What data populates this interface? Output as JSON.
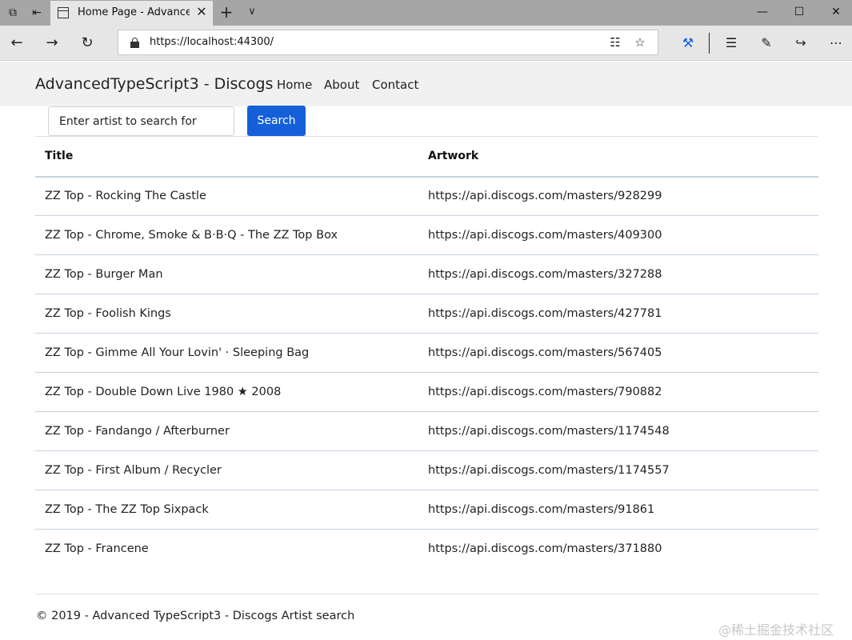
{
  "browser": {
    "tab_title": "Home Page - Advanced",
    "url": "https://localhost:44300/",
    "icons": {
      "tab_actions": "⧉",
      "back_to_tabs": "⇤",
      "close_tab": "✕",
      "new_tab": "+",
      "tab_menu": "∨",
      "minimize": "—",
      "maximize": "☐",
      "close_window": "✕",
      "back": "←",
      "forward": "→",
      "refresh": "↻",
      "reading_view": "☷",
      "favorite": "☆",
      "extension": "⚒",
      "favorites_hub": "☰",
      "pen": "✎",
      "share": "↪",
      "more": "⋯"
    }
  },
  "header": {
    "brand": "AdvancedTypeScript3 - Discogs",
    "nav": [
      "Home",
      "About",
      "Contact"
    ]
  },
  "search": {
    "placeholder": "Enter artist to search for",
    "button_label": "Search"
  },
  "table": {
    "headers": [
      "Title",
      "Artwork"
    ],
    "rows": [
      [
        "ZZ Top - Rocking The Castle",
        "https://api.discogs.com/masters/928299"
      ],
      [
        "ZZ Top - Chrome, Smoke & B·B·Q - The ZZ Top Box",
        "https://api.discogs.com/masters/409300"
      ],
      [
        "ZZ Top - Burger Man",
        "https://api.discogs.com/masters/327288"
      ],
      [
        "ZZ Top - Foolish Kings",
        "https://api.discogs.com/masters/427781"
      ],
      [
        "ZZ Top - Gimme All Your Lovin' · Sleeping Bag",
        "https://api.discogs.com/masters/567405"
      ],
      [
        "ZZ Top - Double Down Live 1980 ★ 2008",
        "https://api.discogs.com/masters/790882"
      ],
      [
        "ZZ Top - Fandango / Afterburner",
        "https://api.discogs.com/masters/1174548"
      ],
      [
        "ZZ Top - First Album / Recycler",
        "https://api.discogs.com/masters/1174557"
      ],
      [
        "ZZ Top - The ZZ Top Sixpack",
        "https://api.discogs.com/masters/91861"
      ],
      [
        "ZZ Top - Francene",
        "https://api.discogs.com/masters/371880"
      ]
    ]
  },
  "footer": {
    "text": "© 2019 - Advanced TypeScript3 - Discogs Artist search"
  },
  "watermark": "@稀土掘金技术社区",
  "colors": {
    "primary_button": "#1560d8",
    "header_bg": "#ececec",
    "chrome_tabbar": "#a6a6a6"
  }
}
